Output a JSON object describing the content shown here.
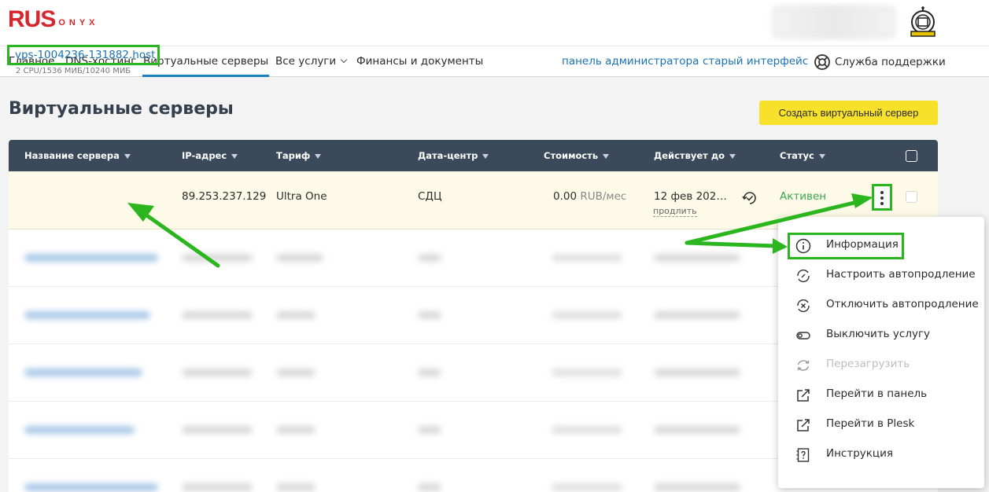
{
  "brand": {
    "logo_main": "RUS",
    "logo_tail": "ONYX",
    "accent": "#d6262e"
  },
  "nav": {
    "items": [
      "Главное",
      "DNS-хостинг",
      "Виртуальные серверы",
      "Все услуги",
      "Финансы и документы"
    ],
    "active_index": 2,
    "links": [
      "панель администратора",
      "старый интерфейс"
    ],
    "support_label": "Служба поддержки"
  },
  "page": {
    "title": "Виртуальные серверы",
    "create_button": "Создать виртуальный сервер"
  },
  "table": {
    "headers": [
      "Название сервера",
      "IP-адрес",
      "Тариф",
      "Дата-центр",
      "Стоимость",
      "Действует до",
      "Статус"
    ],
    "row": {
      "name": "vps-1004236-131882.host…",
      "specs": "2 CPU/1536 МИБ/10240 МИБ",
      "ip": "89.253.237.129",
      "plan": "Ultra One",
      "datacenter": "СДЦ",
      "cost_value": "0.00",
      "cost_unit": "RUB/мес",
      "valid_until": "12 фев 202…",
      "extend_label": "продлить",
      "status": "Активен",
      "status_color": "#3aa656"
    }
  },
  "menu": {
    "items": [
      {
        "label": "Информация",
        "icon": "info-icon",
        "disabled": false
      },
      {
        "label": "Настроить автопродление",
        "icon": "autorenew-icon",
        "disabled": false
      },
      {
        "label": "Отключить автопродление",
        "icon": "autorenew-off-icon",
        "disabled": false
      },
      {
        "label": "Выключить услугу",
        "icon": "toggle-icon",
        "disabled": false
      },
      {
        "label": "Перезагрузить",
        "icon": "reload-icon",
        "disabled": true
      },
      {
        "label": "Перейти в панель",
        "icon": "external-link-icon",
        "disabled": false
      },
      {
        "label": "Перейти в Plesk",
        "icon": "external-link-icon",
        "disabled": false
      },
      {
        "label": "Инструкция",
        "icon": "help-doc-icon",
        "disabled": false
      }
    ]
  },
  "annotation": {
    "highlight_color": "#2bb51f"
  }
}
